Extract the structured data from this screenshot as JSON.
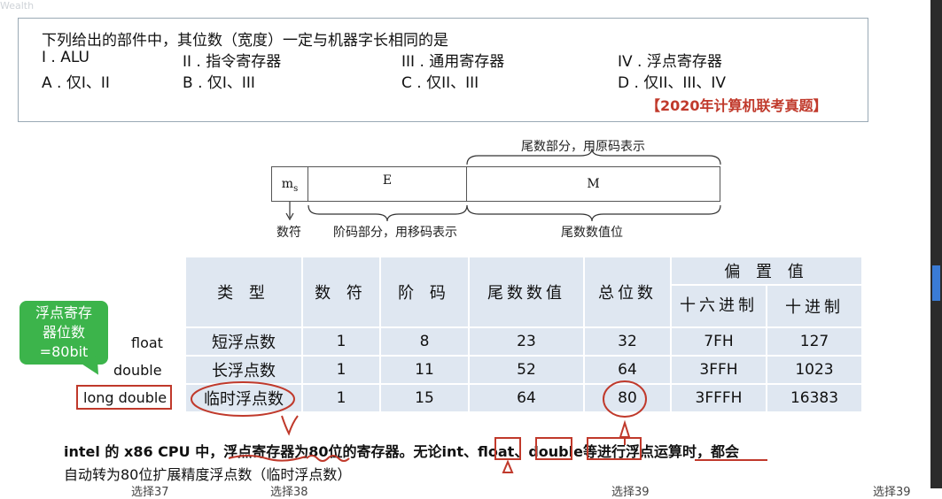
{
  "question": {
    "title": "下列给出的部件中，其位数（宽度）一定与机器字长相同的是",
    "items": [
      "I . ALU",
      "II . 指令寄存器",
      "III . 通用寄存器",
      "IV . 浮点寄存器"
    ],
    "options": [
      "A . 仅I、II",
      "B . 仅I、III",
      "C . 仅II、III",
      "D . 仅II、III、IV"
    ],
    "source": "【2020年计算机联考真题】"
  },
  "diagram": {
    "mantissa_part_label": "尾数部分，用原码表示",
    "cells": {
      "sign": "m",
      "sign_sub": "s",
      "exponent": "E",
      "mantissa": "M"
    },
    "sign_label": "数符",
    "exponent_label": "阶码部分，用移码表示",
    "mantissa_value_label": "尾数数值位"
  },
  "table": {
    "headers": {
      "type": "类  型",
      "sign": "数  符",
      "exponent": "阶  码",
      "mantissa": "尾数数值",
      "total": "总位数",
      "bias": "偏 置 值",
      "hex": "十六进制",
      "dec": "十进制"
    },
    "rows": [
      {
        "label": "float",
        "type": "短浮点数",
        "sign": "1",
        "exponent": "8",
        "mantissa": "23",
        "total": "32",
        "hex": "7FH",
        "dec": "127"
      },
      {
        "label": "double",
        "type": "长浮点数",
        "sign": "1",
        "exponent": "11",
        "mantissa": "52",
        "total": "64",
        "hex": "3FFH",
        "dec": "1023"
      },
      {
        "label": "long double",
        "type": "临时浮点数",
        "sign": "1",
        "exponent": "15",
        "mantissa": "64",
        "total": "80",
        "hex": "3FFFH",
        "dec": "16383"
      }
    ]
  },
  "callout": {
    "line1": "浮点寄存",
    "line2": "器位数",
    "line3": "=80bit"
  },
  "note": {
    "line1_a": "intel 的 x86 CPU 中，浮点寄存器为",
    "line1_b": "80",
    "line1_c": "位的寄存器。无论",
    "kw_int": "int",
    "sep1": "、",
    "kw_float": "float",
    "sep2": "、",
    "kw_double": "double",
    "line1_d": "等进行浮点运算时，都会",
    "line2": "自动转为80位扩展精度浮点数（临时浮点数）"
  },
  "bottom": {
    "a": "选择37",
    "b": "选择38",
    "c": "选择39",
    "d": "选择39"
  },
  "colors": {
    "accent_red": "#c0392b",
    "table_bg": "#dfe7f1",
    "callout_green": "#3cb44b"
  }
}
